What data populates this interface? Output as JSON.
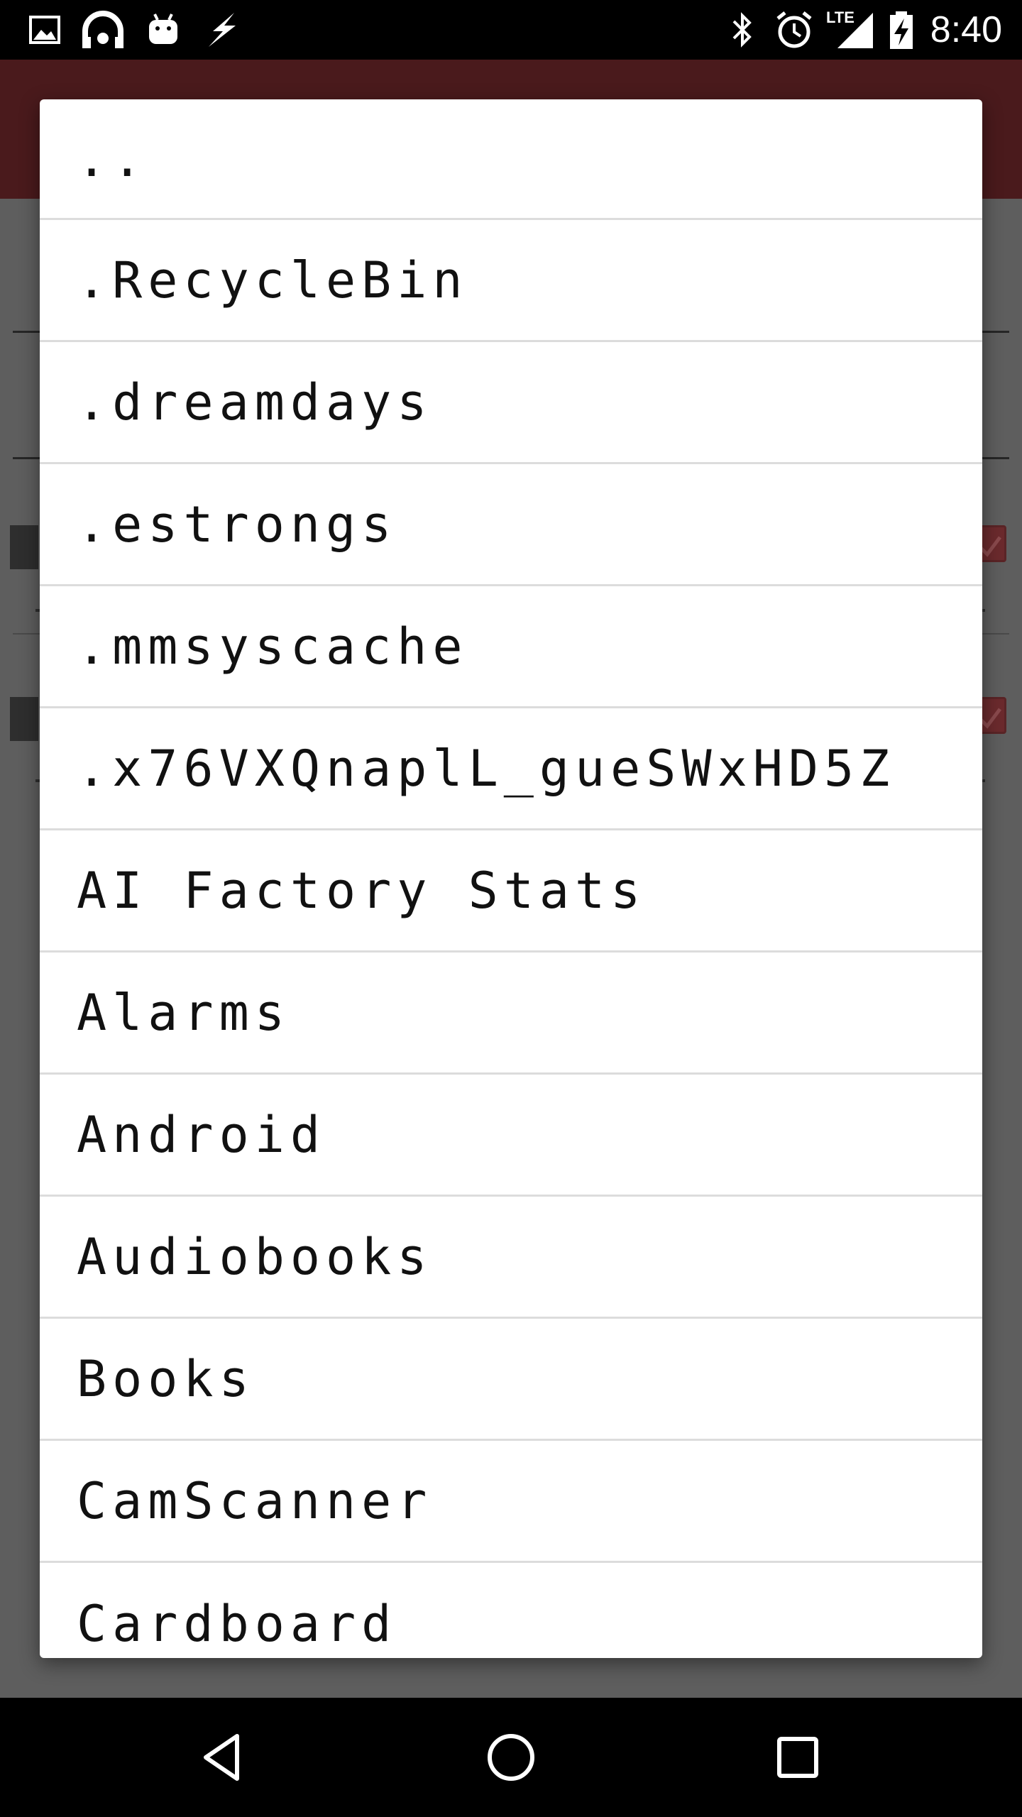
{
  "status_bar": {
    "time": "8:40",
    "network_label": "LTE",
    "left_icons": [
      "image-icon",
      "headset-app-icon",
      "android-debug-icon",
      "lightning-icon"
    ],
    "right_icons": [
      "bluetooth-icon",
      "alarm-icon",
      "signal-icon",
      "battery-charging-icon"
    ]
  },
  "dialog": {
    "items": [
      {
        "label": ".."
      },
      {
        "label": ".RecycleBin"
      },
      {
        "label": ".dreamdays"
      },
      {
        "label": ".estrongs"
      },
      {
        "label": ".mmsyscache"
      },
      {
        "label": ".x76VXQnaplL_gueSWxHD5Z"
      },
      {
        "label": "AI Factory Stats"
      },
      {
        "label": "Alarms"
      },
      {
        "label": "Android"
      },
      {
        "label": "Audiobooks"
      },
      {
        "label": "Books"
      },
      {
        "label": "CamScanner"
      },
      {
        "label": "Cardboard"
      }
    ]
  },
  "nav_bar": {
    "buttons": [
      "back-icon",
      "home-icon",
      "recents-icon"
    ]
  },
  "colors": {
    "toolbar": "#4a1a1c",
    "scrim_background": "#5e5e5e",
    "checkbox_accent": "#6b2a2d",
    "dialog_background": "#ffffff",
    "divider": "#dcdcdc"
  }
}
